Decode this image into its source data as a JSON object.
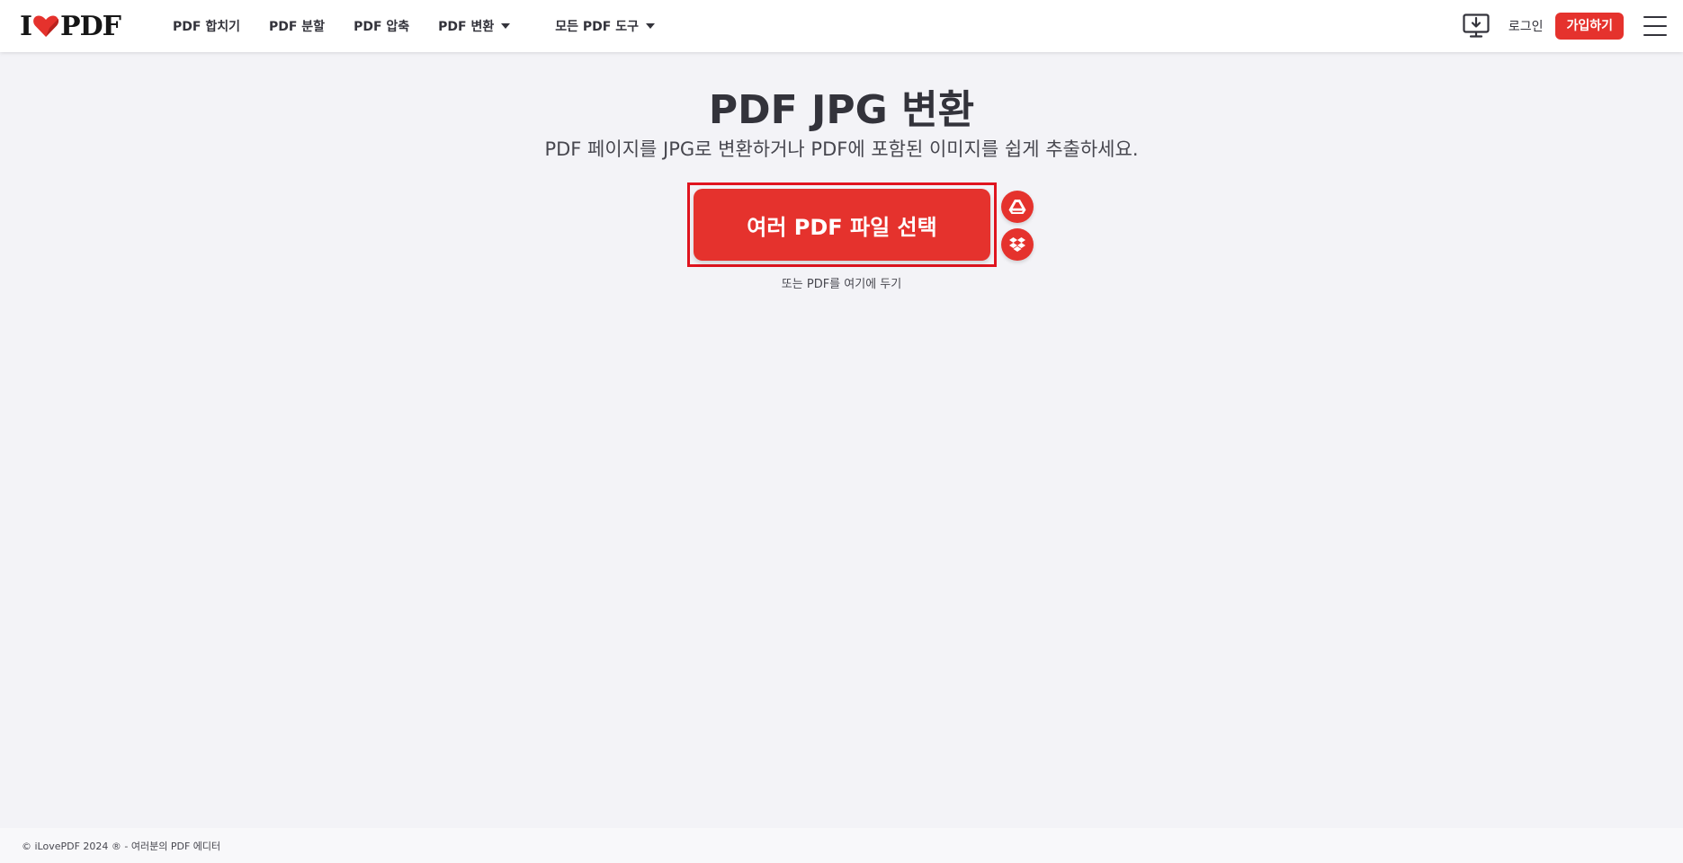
{
  "header": {
    "logo": {
      "left": "I",
      "right": "PDF"
    },
    "nav": [
      {
        "label": "PDF 합치기"
      },
      {
        "label": "PDF 분할"
      },
      {
        "label": "PDF 압축"
      },
      {
        "label": "PDF 변환",
        "has_dropdown": true
      },
      {
        "label": "모든 PDF 도구",
        "has_dropdown": true
      }
    ],
    "login_label": "로그인",
    "signup_label": "가입하기"
  },
  "hero": {
    "title": "PDF JPG 변환",
    "subtitle": "PDF 페이지를 JPG로 변환하거나 PDF에 포함된 이미지를 쉽게 추출하세요.",
    "select_button": "여러 PDF 파일 선택",
    "drop_hint": "또는 PDF를 여기에 두기"
  },
  "icons": {
    "desktop": "desktop-download-icon",
    "menu": "hamburger-menu-icon",
    "gdrive": "google-drive-icon",
    "dropbox": "dropbox-icon",
    "heart": "heart-logo-icon"
  },
  "colors": {
    "brand": "#e5322d",
    "highlight_frame": "#e0141f",
    "background": "#f3f3f7",
    "text": "#33333b"
  },
  "footer": {
    "text": "© iLovePDF 2024 ® - 여러분의 PDF 에디터"
  }
}
